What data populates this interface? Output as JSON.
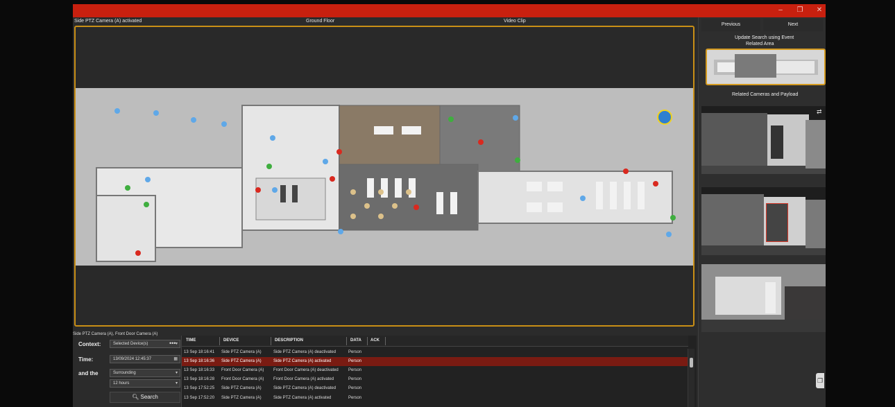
{
  "window": {
    "minimize_glyph": "–",
    "restore_glyph": "❐",
    "close_glyph": "✕",
    "accent_color": "#c8200f"
  },
  "header": {
    "left_title": "Side PTZ Camera (A) activated",
    "center_title": "Ground Floor",
    "right_title": "Video Clip"
  },
  "map": {
    "highlight_color": "#c98f16",
    "marker_colors": {
      "camera": "#5fa8e8",
      "alarm": "#d9291f",
      "sensor": "#3fae3f",
      "ptz_ring": "#f2d21c"
    }
  },
  "context_devices_label": "Side PTZ Camera (A), Front Door Camera (A)",
  "filters": {
    "context_label": "Context:",
    "context_value": "Selected Device(s)",
    "more_glyph": "•••",
    "time_label": "Time:",
    "time_value": "13/09/2024 12:45:37",
    "and_the_label": "and the",
    "range_value": "Surrounding",
    "duration_value": "12 hours",
    "search_label": "Search",
    "search_icon": "search-icon"
  },
  "event_list": {
    "columns": [
      "TIME",
      "DEVICE",
      "DESCRIPTION",
      "DATA",
      "ACK"
    ],
    "selected_row_color": "#7a1b12",
    "rows": [
      {
        "time": "13 Sep 18:16:41",
        "device": "Side PTZ Camera (A)",
        "description": "Side PTZ Camera (A) deactivated",
        "data": "Person"
      },
      {
        "time": "13 Sep 18:16:36",
        "device": "Side PTZ Camera (A)",
        "description": "Side PTZ Camera (A) activated",
        "data": "Person"
      },
      {
        "time": "13 Sep 18:16:33",
        "device": "Front Door Camera (A)",
        "description": "Front Door Camera (A) deactivated",
        "data": "Person"
      },
      {
        "time": "13 Sep 18:16:28",
        "device": "Front Door Camera (A)",
        "description": "Front Door Camera (A) activated",
        "data": "Person"
      },
      {
        "time": "13 Sep 17:52:25",
        "device": "Side PTZ Camera (A)",
        "description": "Side PTZ Camera (A) deactivated",
        "data": "Person"
      },
      {
        "time": "13 Sep 17:52:20",
        "device": "Side PTZ Camera (A)",
        "description": "Side PTZ Camera (A) activated",
        "data": "Person"
      }
    ]
  },
  "right_panel": {
    "previous_label": "Previous",
    "next_label": "Next",
    "update_search_label": "Update Search using Event",
    "related_area_label": "Related Area",
    "related_cameras_label": "Related Cameras and Payload",
    "swap_icon": "swap-icon"
  }
}
